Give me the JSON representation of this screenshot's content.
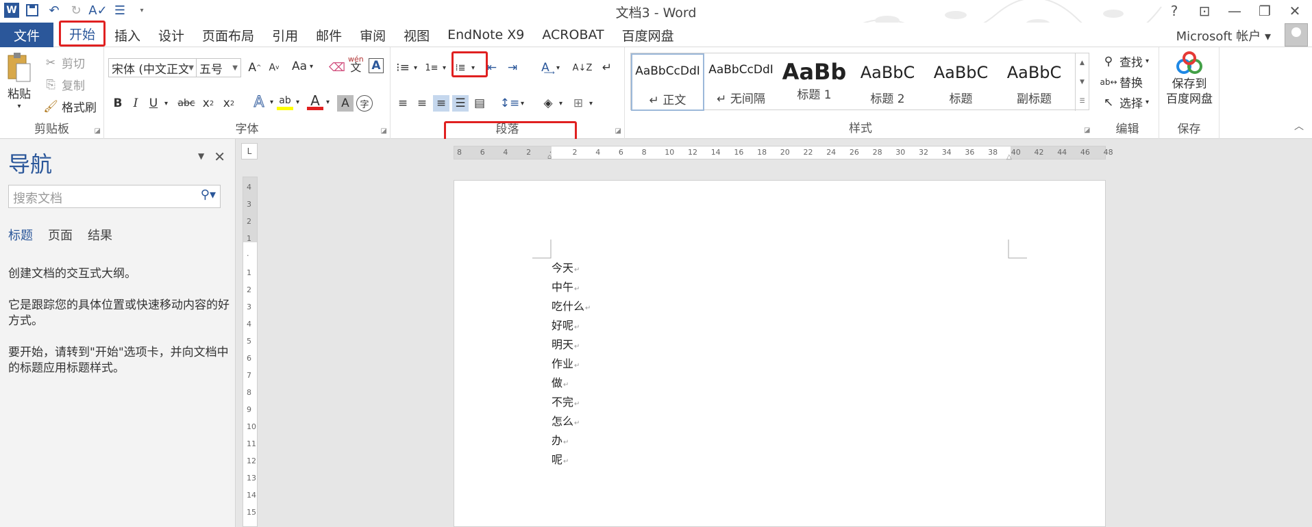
{
  "window": {
    "title": "文档3 - Word",
    "controls": [
      "?",
      "⊡",
      "—",
      "❐",
      "✕"
    ]
  },
  "menu": {
    "file": "文件",
    "tabs": [
      "开始",
      "插入",
      "设计",
      "页面布局",
      "引用",
      "邮件",
      "审阅",
      "视图",
      "EndNote X9",
      "ACROBAT",
      "百度网盘"
    ],
    "active_tab": "开始",
    "account": "Microsoft 帐户 ▾"
  },
  "ribbon": {
    "clipboard": {
      "label": "剪贴板",
      "paste": "粘贴",
      "cut": "剪切",
      "copy": "复制",
      "format_painter": "格式刷"
    },
    "font": {
      "label": "字体",
      "font_name": "宋体 (中文正文",
      "font_size": "五号",
      "case": "Aa",
      "phonetic": "wén"
    },
    "paragraph": {
      "label": "段落"
    },
    "styles": {
      "label": "样式",
      "items": [
        {
          "sample": "AaBbCcDdI",
          "name": "↵ 正文"
        },
        {
          "sample": "AaBbCcDdI",
          "name": "↵ 无间隔"
        },
        {
          "sample": "AaBb",
          "name": "标题 1"
        },
        {
          "sample": "AaBbC",
          "name": "标题 2"
        },
        {
          "sample": "AaBbC",
          "name": "标题"
        },
        {
          "sample": "AaBbC",
          "name": "副标题"
        }
      ]
    },
    "editing": {
      "label": "编辑",
      "find": "查找",
      "replace": "替换",
      "select": "选择"
    },
    "save": {
      "label": "保存",
      "button": "保存到\n百度网盘",
      "line1": "保存到",
      "line2": "百度网盘"
    }
  },
  "nav": {
    "title": "导航",
    "search_placeholder": "搜索文档",
    "tabs": [
      "标题",
      "页面",
      "结果"
    ],
    "text1": "创建文档的交互式大纲。",
    "text2": "它是跟踪您的具体位置或快速移动内容的好方式。",
    "text3": "要开始，请转到\"开始\"选项卡，并向文档中的标题应用标题样式。"
  },
  "ruler": {
    "h_ticks": [
      "8",
      "6",
      "4",
      "2",
      "",
      "2",
      "4",
      "6",
      "8",
      "10",
      "12",
      "14",
      "16",
      "18",
      "20",
      "22",
      "24",
      "26",
      "28",
      "30",
      "32",
      "34",
      "36",
      "38",
      "40",
      "42",
      "44",
      "46",
      "48"
    ],
    "v_ticks": [
      "4",
      "3",
      "2",
      "1",
      "",
      "1",
      "2",
      "3",
      "4",
      "5",
      "6",
      "7",
      "8",
      "9",
      "10",
      "11",
      "12",
      "13",
      "14",
      "15"
    ],
    "corner": "L"
  },
  "document": {
    "lines": [
      "今天",
      "中午",
      "吃什么",
      "好呢",
      "明天",
      "作业",
      "做",
      "不完",
      "怎么",
      "办",
      "呢"
    ]
  },
  "colors": {
    "accent": "#2b579a",
    "highlight": "#e02020"
  }
}
